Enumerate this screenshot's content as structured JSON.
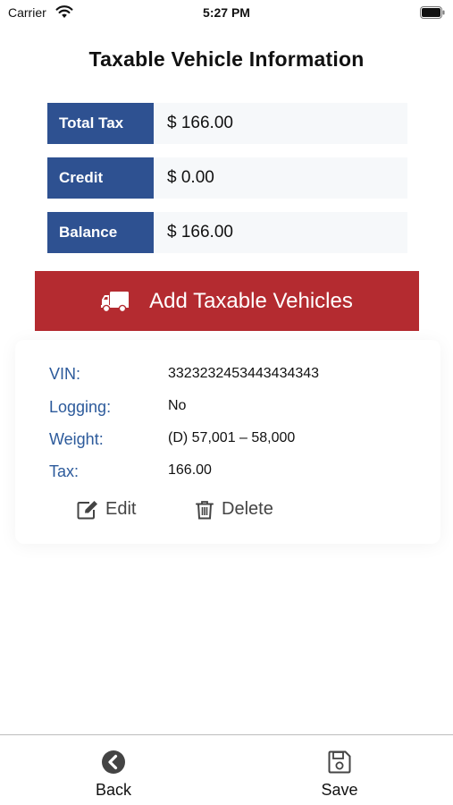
{
  "status_bar": {
    "carrier": "Carrier",
    "time": "5:27 PM"
  },
  "page_title": "Taxable Vehicle Information",
  "summary": {
    "total_tax_label": "Total Tax",
    "total_tax_value": "$ 166.00",
    "credit_label": "Credit",
    "credit_value": "$ 0.00",
    "balance_label": "Balance",
    "balance_value": "$ 166.00"
  },
  "add_button": {
    "label": "Add Taxable Vehicles",
    "icon": "truck-icon",
    "color": "#b42b30"
  },
  "vehicle": {
    "vin_label": "VIN:",
    "vin_value": "3323232453443434343",
    "logging_label": "Logging:",
    "logging_value": "No",
    "weight_label": "Weight:",
    "weight_value": "(D) 57,001 – 58,000",
    "tax_label": "Tax:",
    "tax_value": "166.00",
    "edit_label": "Edit",
    "delete_label": "Delete"
  },
  "bottom_bar": {
    "back_label": "Back",
    "save_label": "Save"
  },
  "colors": {
    "label_bg": "#2e5191",
    "label_text": "#2c5a9b",
    "value_bg": "#f6f8fa"
  }
}
